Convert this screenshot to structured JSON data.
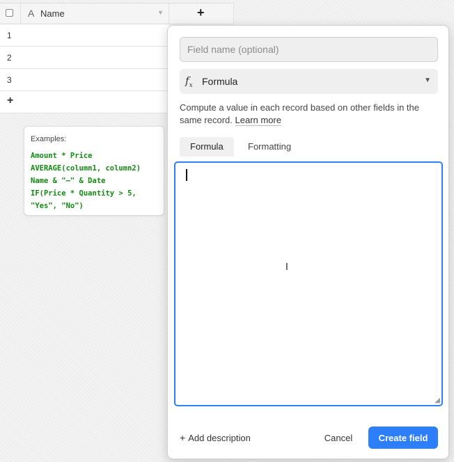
{
  "grid": {
    "column_name": "Name",
    "field_type_icon": "text-field-icon",
    "add_column_icon": "+",
    "rows": [
      "1",
      "2",
      "3"
    ],
    "add_row_icon": "+"
  },
  "examples": {
    "title": "Examples:",
    "lines": "Amount * Price\nAVERAGE(column1, column2)\nName & \"—\" & Date\nIF(Price * Quantity > 5,\n\"Yes\", \"No\")"
  },
  "panel": {
    "field_name": {
      "value": "",
      "placeholder": "Field name (optional)"
    },
    "type": {
      "label": "Formula",
      "icon": "formula-fx-icon"
    },
    "description": "Compute a value in each record based on other fields in the same record.",
    "learn_more": "Learn more",
    "tabs": [
      {
        "label": "Formula",
        "active": true
      },
      {
        "label": "Formatting",
        "active": false
      }
    ],
    "formula_value": "",
    "add_description": "Add description",
    "cancel_label": "Cancel",
    "create_label": "Create field"
  },
  "colors": {
    "accent": "#2d7ff9",
    "example_code": "#108a10"
  }
}
